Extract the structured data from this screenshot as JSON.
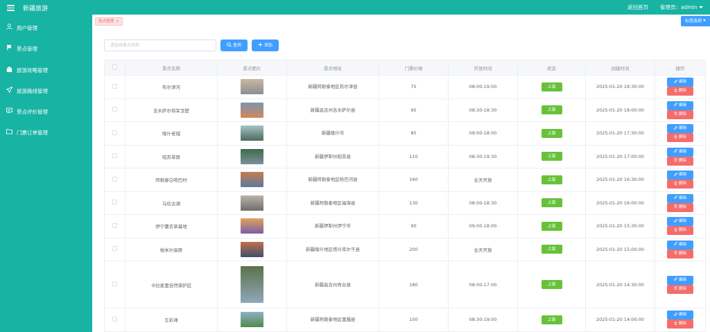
{
  "header": {
    "title": "新疆旅游",
    "home_link": "返回首页",
    "admin_label": "管理员：admin"
  },
  "sidebar": {
    "items": [
      {
        "label": "用户管理",
        "icon": "user-icon"
      },
      {
        "label": "景点管理",
        "icon": "flag-icon"
      },
      {
        "label": "旅游攻略管理",
        "icon": "bank-icon"
      },
      {
        "label": "旅游路线管理",
        "icon": "send-icon"
      },
      {
        "label": "景点评价管理",
        "icon": "comment-icon"
      },
      {
        "label": "门票订单管理",
        "icon": "folder-icon"
      }
    ]
  },
  "tags": {
    "active_tag": "景点管理",
    "close": "×",
    "options_label": "标签选项"
  },
  "toolbar": {
    "search_placeholder": "请选择景点名称",
    "search_label": "查询",
    "add_label": "添加"
  },
  "table": {
    "headers": [
      "景点名称",
      "景点图片",
      "景点地址",
      "门票价格",
      "开放时间",
      "状态",
      "创建时间",
      "操作"
    ],
    "edit_label": "编辑",
    "delete_label": "删除",
    "rows": [
      {
        "name": "布尔津河",
        "address": "新疆阿勒泰地区布尔津县",
        "price": "75",
        "hours": "08:00-19:00",
        "status": "上架",
        "created": "2025-01-20 18:30:00",
        "colors": [
          "#8a8f93",
          "#c9b8a0"
        ]
      },
      {
        "name": "吉木萨尔将军戈壁",
        "address": "新疆昌吉州吉木萨尔县",
        "price": "95",
        "hours": "08:30-18:30",
        "status": "上架",
        "created": "2025-01-20 18:00:00",
        "colors": [
          "#d4865a",
          "#7a94b0"
        ]
      },
      {
        "name": "喀什老城",
        "address": "新疆喀什市",
        "price": "85",
        "hours": "09:00-18:00",
        "status": "上架",
        "created": "2025-01-20 17:30:00",
        "colors": [
          "#4b6a5a",
          "#a7c3c9"
        ]
      },
      {
        "name": "昭苏草原",
        "address": "新疆伊犁州昭苏县",
        "price": "110",
        "hours": "08:30-19:30",
        "status": "上架",
        "created": "2025-01-20 17:00:00",
        "colors": [
          "#7d8f9e",
          "#3f6b4a"
        ]
      },
      {
        "name": "阿勒泰白哈巴村",
        "address": "新疆阿勒泰地区哈巴河县",
        "price": "160",
        "hours": "全天开放",
        "status": "上架",
        "created": "2025-01-20 16:30:00",
        "colors": [
          "#5d7aa0",
          "#c47d4e"
        ]
      },
      {
        "name": "乌伦古湖",
        "address": "新疆阿勒泰地区福海县",
        "price": "130",
        "hours": "08:00-18:30",
        "status": "上架",
        "created": "2025-01-20 16:00:00",
        "colors": [
          "#6f6e6b",
          "#b9b3a9"
        ]
      },
      {
        "name": "伊宁薰衣草基地",
        "address": "新疆伊犁州伊宁市",
        "price": "90",
        "hours": "09:00-18:00",
        "status": "上架",
        "created": "2025-01-20 15:30:00",
        "colors": [
          "#7a5fa8",
          "#e2a05c"
        ]
      },
      {
        "name": "帕米尔高原",
        "address": "新疆喀什地区塔什库尔干县",
        "price": "200",
        "hours": "全天开放",
        "status": "上架",
        "created": "2025-01-20 15:00:00",
        "colors": [
          "#3d4f6d",
          "#c2704a"
        ]
      },
      {
        "name": "卡拉麦里自然保护区",
        "address": "新疆昌吉州奇台县",
        "price": "180",
        "hours": "08:00-17:00",
        "status": "上架",
        "created": "2025-01-20 14:30:00",
        "colors": [
          "#8fa8bc",
          "#5b7247"
        ]
      },
      {
        "name": "五彩滩",
        "address": "新疆阿勒泰地区富蕴县",
        "price": "100",
        "hours": "08:30-19:00",
        "status": "上架",
        "created": "2025-01-20 14:00:00",
        "colors": [
          "#4f8a4a",
          "#8fb0c7"
        ]
      }
    ]
  }
}
